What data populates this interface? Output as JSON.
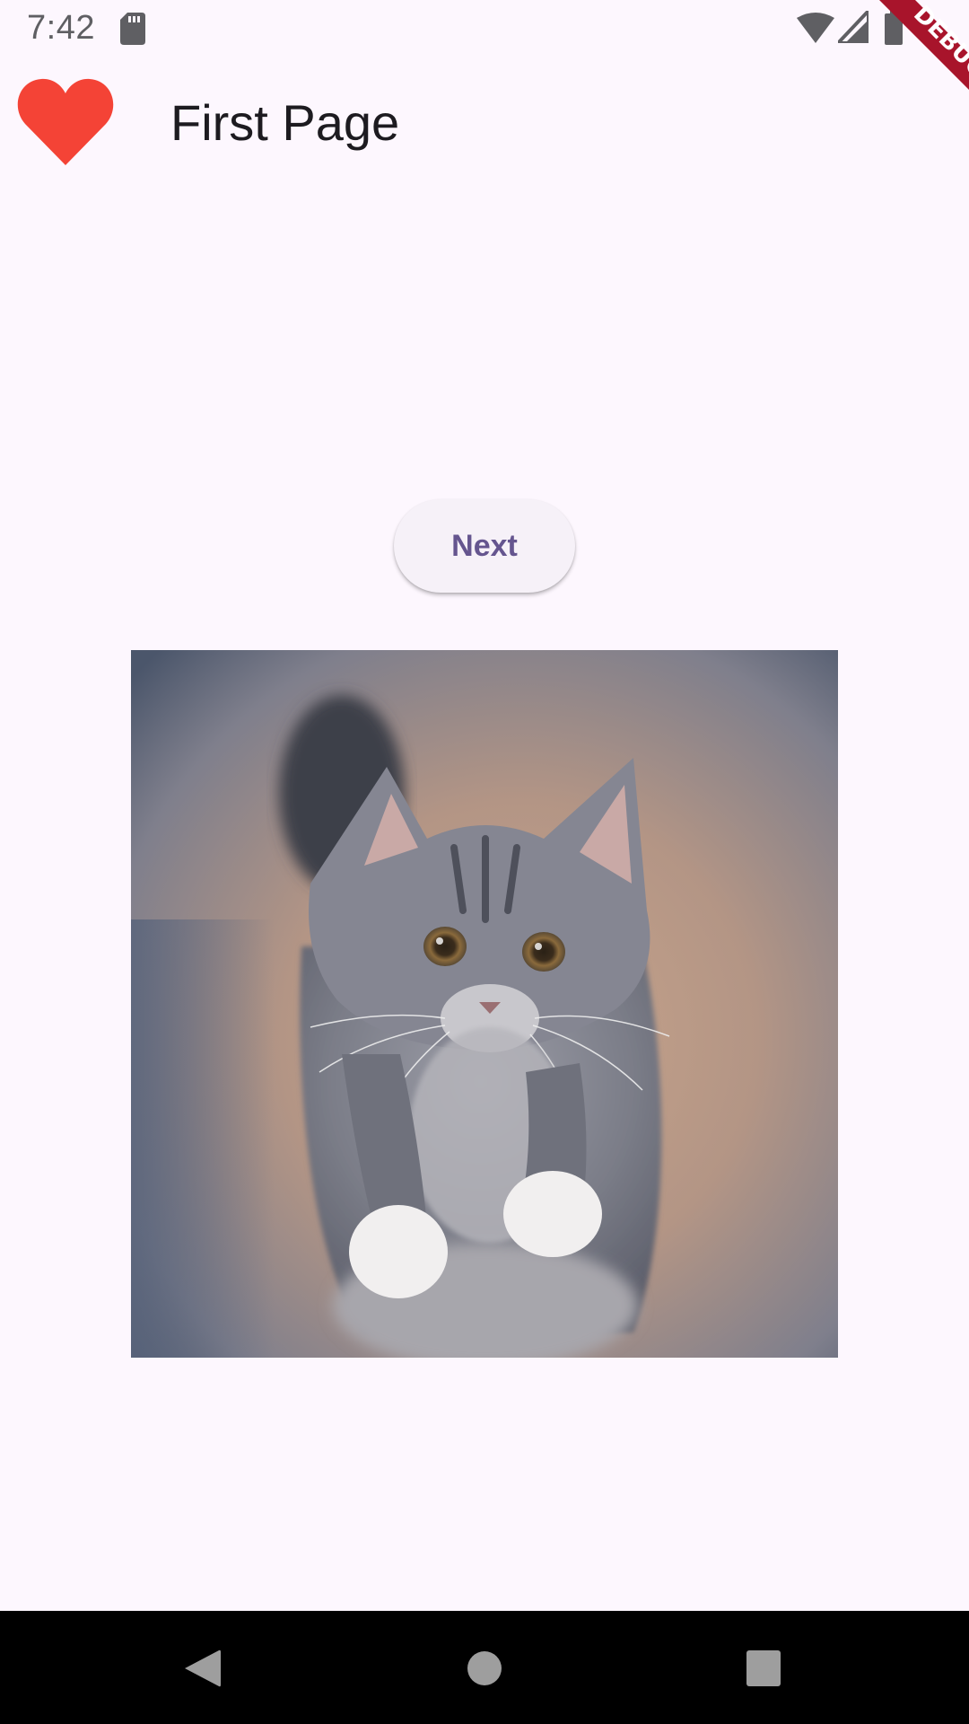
{
  "status_bar": {
    "time": "7:42",
    "icons": [
      "sd-card-icon",
      "wifi-icon",
      "cellular-signal-icon",
      "battery-icon"
    ]
  },
  "debug_banner": {
    "label": "DEBUG",
    "color": "#a8142b"
  },
  "app_bar": {
    "leading_icon": "heart-icon",
    "leading_icon_color": "#f44336",
    "title": "First Page"
  },
  "main": {
    "next_button_label": "Next",
    "accent_color": "#65558f",
    "image": "kitten-photo"
  },
  "nav_bar": {
    "icons": [
      "back-icon",
      "home-icon",
      "recents-icon"
    ]
  },
  "colors": {
    "background": "#fdf7fe",
    "button_surface": "#f6f1f8",
    "title_text": "#1d1b20"
  }
}
